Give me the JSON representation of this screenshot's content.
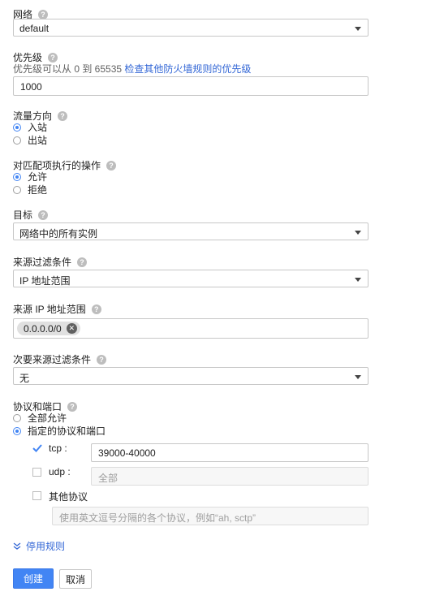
{
  "network": {
    "label": "网络",
    "value": "default"
  },
  "priority": {
    "label": "优先级",
    "hint": "优先级可以从 0 到 65535",
    "hint_link": "检查其他防火墙规则的优先级",
    "value": "1000"
  },
  "direction": {
    "label": "流量方向",
    "options": [
      "入站",
      "出站"
    ],
    "selected": "入站"
  },
  "action": {
    "label": "对匹配项执行的操作",
    "options": [
      "允许",
      "拒绝"
    ],
    "selected": "允许"
  },
  "target": {
    "label": "目标",
    "value": "网络中的所有实例"
  },
  "source_filter": {
    "label": "来源过滤条件",
    "value": "IP 地址范围"
  },
  "source_ip": {
    "label": "来源 IP 地址范围",
    "chip": "0.0.0.0/0"
  },
  "secondary_filter": {
    "label": "次要来源过滤条件",
    "value": "无"
  },
  "protocols": {
    "label": "协议和端口",
    "options": [
      "全部允许",
      "指定的协议和端口"
    ],
    "selected": "指定的协议和端口",
    "tcp": {
      "label": "tcp :",
      "checked": true,
      "value": "39000-40000"
    },
    "udp": {
      "label": "udp :",
      "checked": false,
      "value": "全部"
    },
    "other": {
      "label": "其他协议",
      "checked": false,
      "placeholder": "使用英文逗号分隔的各个协议，例如“ah, sctp”"
    }
  },
  "disable_rule": {
    "label": "停用规则"
  },
  "buttons": {
    "create": "创建",
    "cancel": "取消"
  },
  "colors": {
    "accent": "#4285f4",
    "link": "#3367d6"
  }
}
